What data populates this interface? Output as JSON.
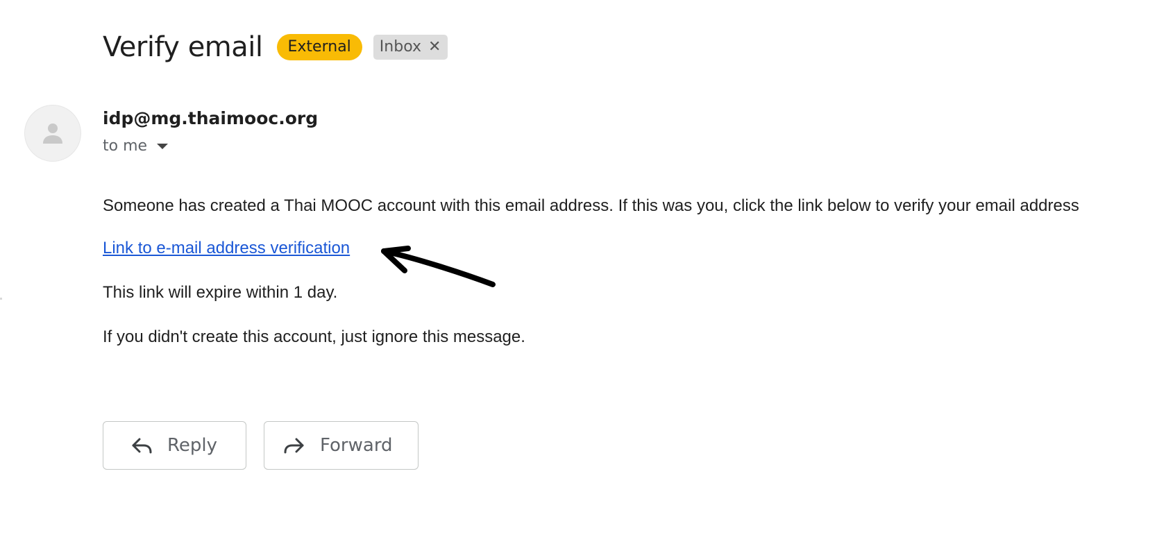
{
  "message": {
    "subject": "Verify email",
    "labels": {
      "external": "External",
      "inbox": "Inbox",
      "inbox_remove": "✕"
    },
    "sender": "idp@mg.thaimooc.org",
    "recipient": "to me",
    "body": {
      "paragraph_1": "Someone has created a Thai MOOC account with this email address. If this was you, click the link below to verify your email address",
      "link_text": "Link to e-mail address verification",
      "paragraph_2": "This link will expire within 1 day.",
      "paragraph_3": "If you didn't create this account, just ignore this message."
    }
  },
  "actions": {
    "reply": "Reply",
    "forward": "Forward"
  },
  "colors": {
    "external_label": "#f9bb05",
    "inbox_label": "#dddddd",
    "link": "#1a57d6"
  },
  "icons": {
    "avatar": "person-icon",
    "recipient_toggle": "caret-down-icon",
    "reply": "reply-icon",
    "forward": "forward-icon",
    "annotation": "hand-drawn-arrow"
  }
}
